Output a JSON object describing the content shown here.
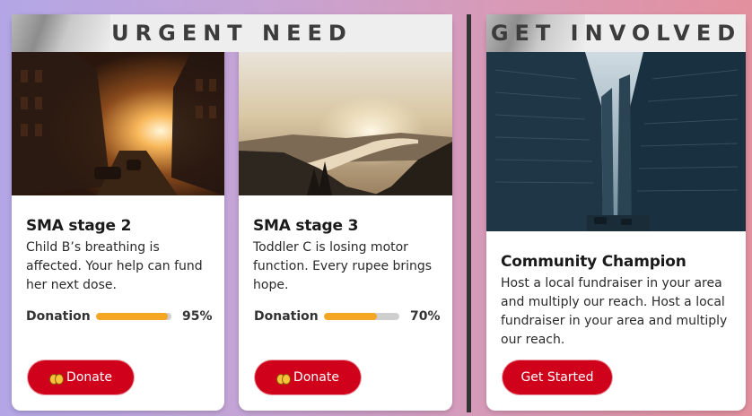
{
  "sections": {
    "urgent": "URGENT NEED",
    "involved": "GET INVOLVED"
  },
  "cards": [
    {
      "title": "SMA stage 2",
      "text": "Child B’s breathing is affected. Your help can fund her next dose.",
      "donation_label": "Donation",
      "progress": 0.95,
      "percent": "95%",
      "button": "Donate",
      "button_icon": "coins-icon"
    },
    {
      "title": "SMA stage 3",
      "text": "Toddler C is losing motor function. Every rupee brings hope.",
      "donation_label": "Donation",
      "progress": 0.7,
      "percent": "70%",
      "button": "Donate",
      "button_icon": "coins-icon"
    }
  ],
  "champion": {
    "title": "Community Champion",
    "text": "Host a local fundraiser in your area and multiply our reach. Host a local fundraiser in your area and multiply our reach.",
    "button": "Get Started"
  },
  "colors": {
    "accent_button": "#d0021b",
    "progress_fill": "#f5a623",
    "progress_track": "#cfcfcf"
  }
}
